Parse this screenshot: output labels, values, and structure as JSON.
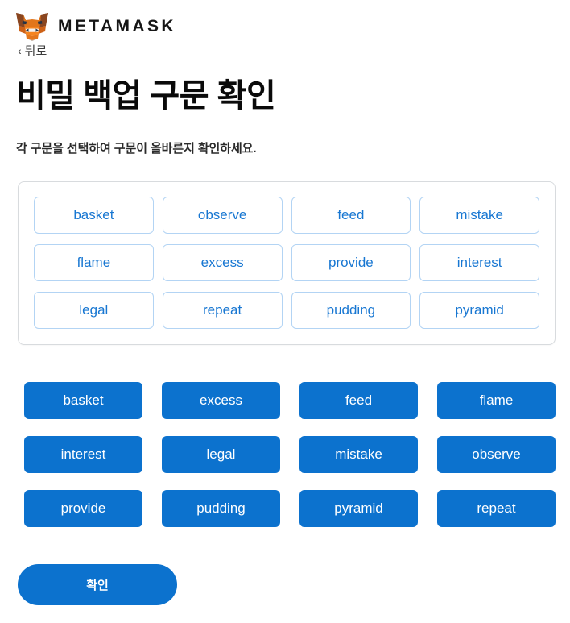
{
  "header": {
    "logo_icon": "metamask-fox-icon",
    "wordmark": "METAMASK",
    "back_label": "뒤로",
    "back_chevron": "‹",
    "back_icon": "chevron-left-icon"
  },
  "main": {
    "title": "비밀 백업 구문 확인",
    "subtitle": "각 구문을 선택하여 구문이 올바른지 확인하세요."
  },
  "selected_phrase": {
    "words": [
      "basket",
      "observe",
      "feed",
      "mistake",
      "flame",
      "excess",
      "provide",
      "interest",
      "legal",
      "repeat",
      "pudding",
      "pyramid"
    ]
  },
  "word_bank": {
    "words": [
      "basket",
      "excess",
      "feed",
      "flame",
      "interest",
      "legal",
      "mistake",
      "observe",
      "provide",
      "pudding",
      "pyramid",
      "repeat"
    ]
  },
  "footer": {
    "confirm_label": "확인"
  },
  "colors": {
    "accent_blue": "#0c72ce",
    "chip_text": "#1877d2",
    "chip_border": "#b3d4f4",
    "card_border": "#d8dbde",
    "fox_orange": "#e2761b",
    "fox_dark": "#763d16",
    "fox_light": "#f5841f",
    "background": "#ffffff"
  }
}
